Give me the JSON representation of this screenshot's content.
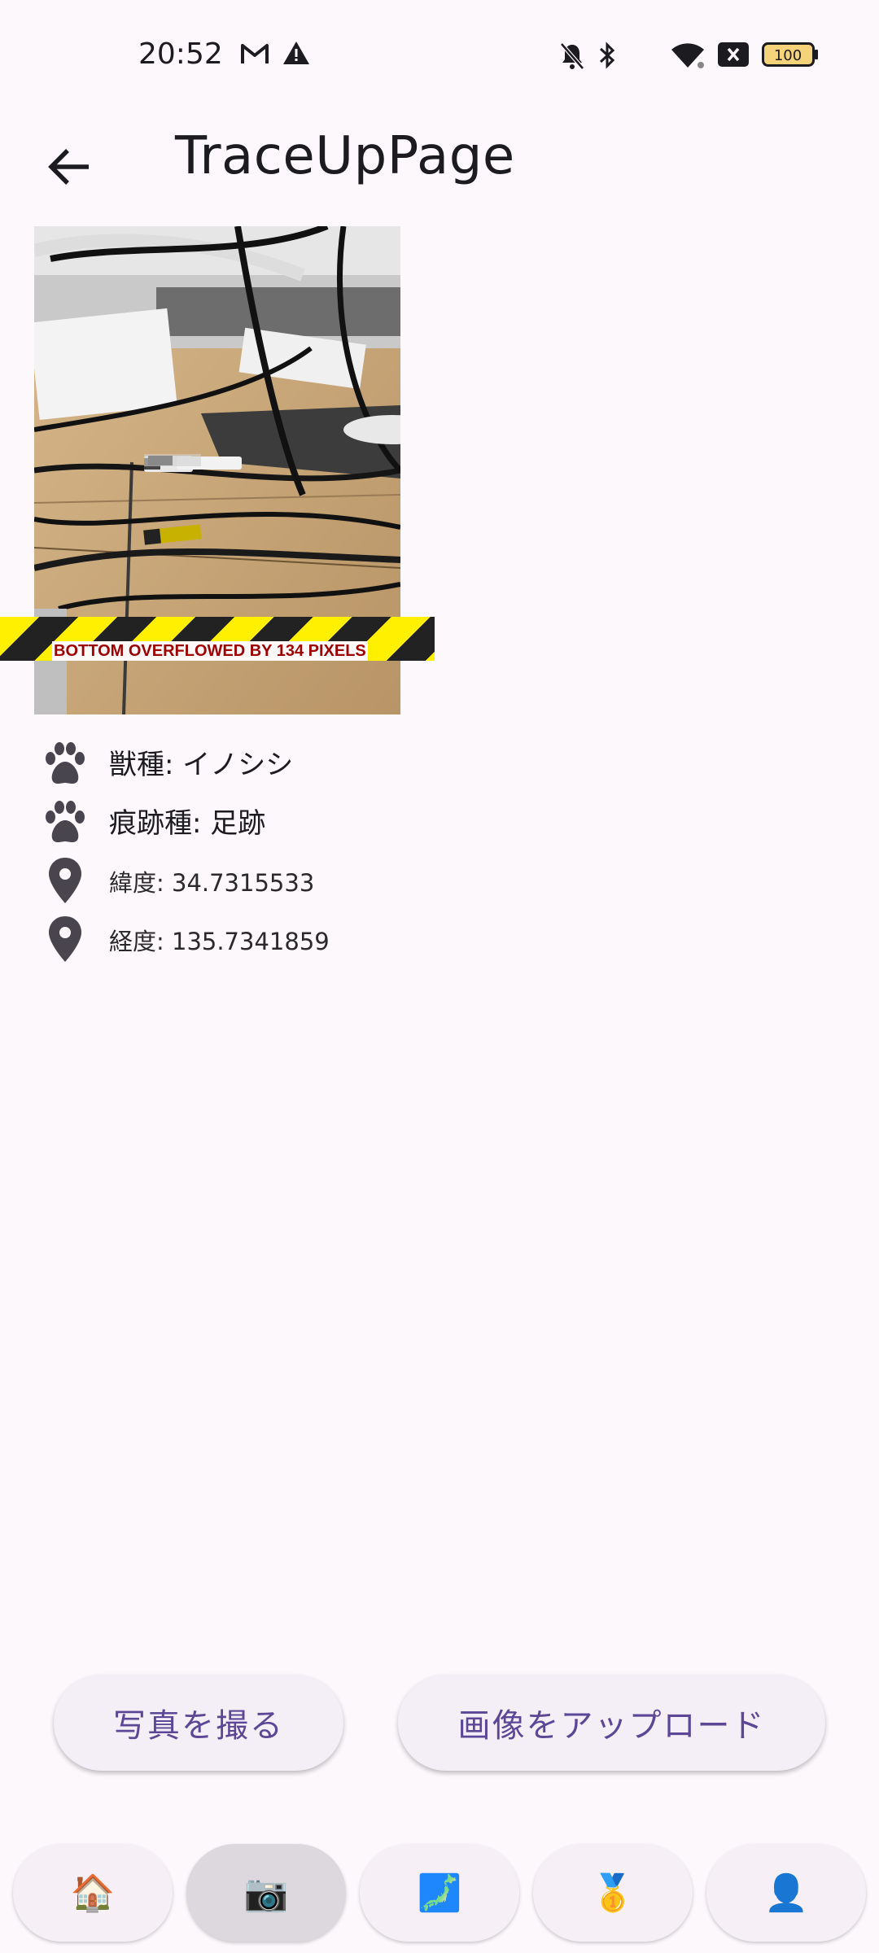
{
  "status_bar": {
    "time": "20:52",
    "battery": "100",
    "icons": [
      "gmail-icon",
      "warning-icon",
      "bell-off-icon",
      "bluetooth-icon",
      "wifi-icon",
      "x-icon",
      "battery-icon"
    ]
  },
  "app_bar": {
    "title": "TraceUpPage",
    "back_icon": "arrow-back-icon"
  },
  "overflow_warning": "BOTTOM OVERFLOWED BY 134 PIXELS",
  "info": {
    "species": "獣種: イノシシ",
    "trace_type": "痕跡種: 足跡",
    "latitude": "緯度: 34.7315533",
    "longitude": "経度: 135.7341859"
  },
  "buttons": {
    "take_photo": "写真を撮る",
    "upload_image": "画像をアップロード"
  },
  "nav": [
    {
      "icon": "home-icon",
      "glyph": "🏠"
    },
    {
      "icon": "camera-icon",
      "glyph": "📷"
    },
    {
      "icon": "map-icon",
      "glyph": "🗾"
    },
    {
      "icon": "medal-icon",
      "glyph": "🥇"
    },
    {
      "icon": "profile-icon",
      "glyph": "👤"
    }
  ],
  "colors": {
    "background": "#fdf8fc",
    "button_text": "#5b4796",
    "button_bg": "#f4eef6"
  }
}
